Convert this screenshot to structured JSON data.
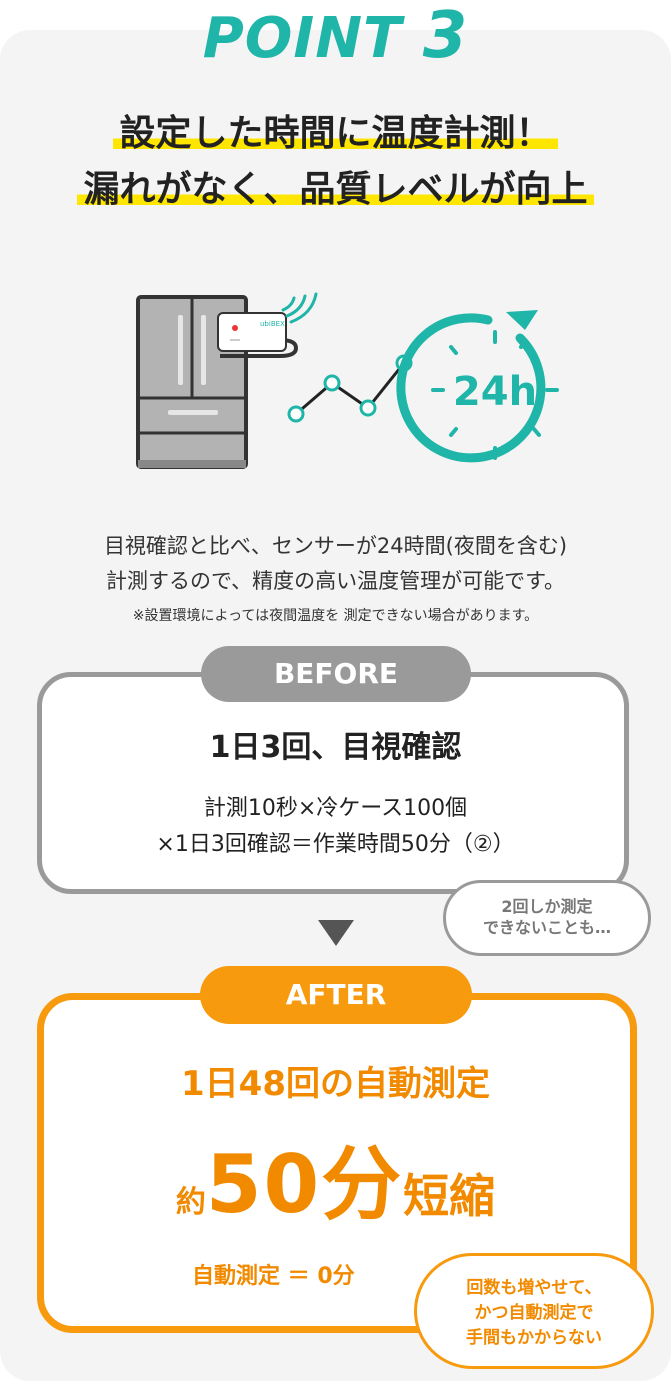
{
  "point": {
    "label": "POINT",
    "number": "3"
  },
  "headline": {
    "line1": "設定した時間に温度計測！",
    "line2": "漏れがなく、品質レベルが向上"
  },
  "illustration": {
    "device_brand": "ubiBEX",
    "clock_label": "24h"
  },
  "description": {
    "line1": "目視確認と比べ、センサーが24時間(夜間を含む)",
    "line2": "計測するので、精度の高い温度管理が可能です。",
    "note": "※設置環境によっては夜間温度を 測定できない場合があります。"
  },
  "before": {
    "label": "BEFORE",
    "title": "1日3回、目視確認",
    "line1": "計測10秒×冷ケース100個",
    "line2": "×1日3回確認＝作業時間50分（②）",
    "bubble_line1": "2回しか測定",
    "bubble_line2": "できないことも…"
  },
  "after": {
    "label": "AFTER",
    "title": "1日48回の自動測定",
    "big_prefix": "約",
    "big_number": "50分",
    "big_suffix": "短縮",
    "detail": "自動測定 ＝ 0分",
    "bubble_line1": "回数も増やせて、",
    "bubble_line2": "かつ自動測定で",
    "bubble_line3": "手間もかからない"
  },
  "colors": {
    "teal": "#1fb5a8",
    "orange": "#f79a0e",
    "gray": "#9a9a9a",
    "highlight": "#ffe600"
  }
}
